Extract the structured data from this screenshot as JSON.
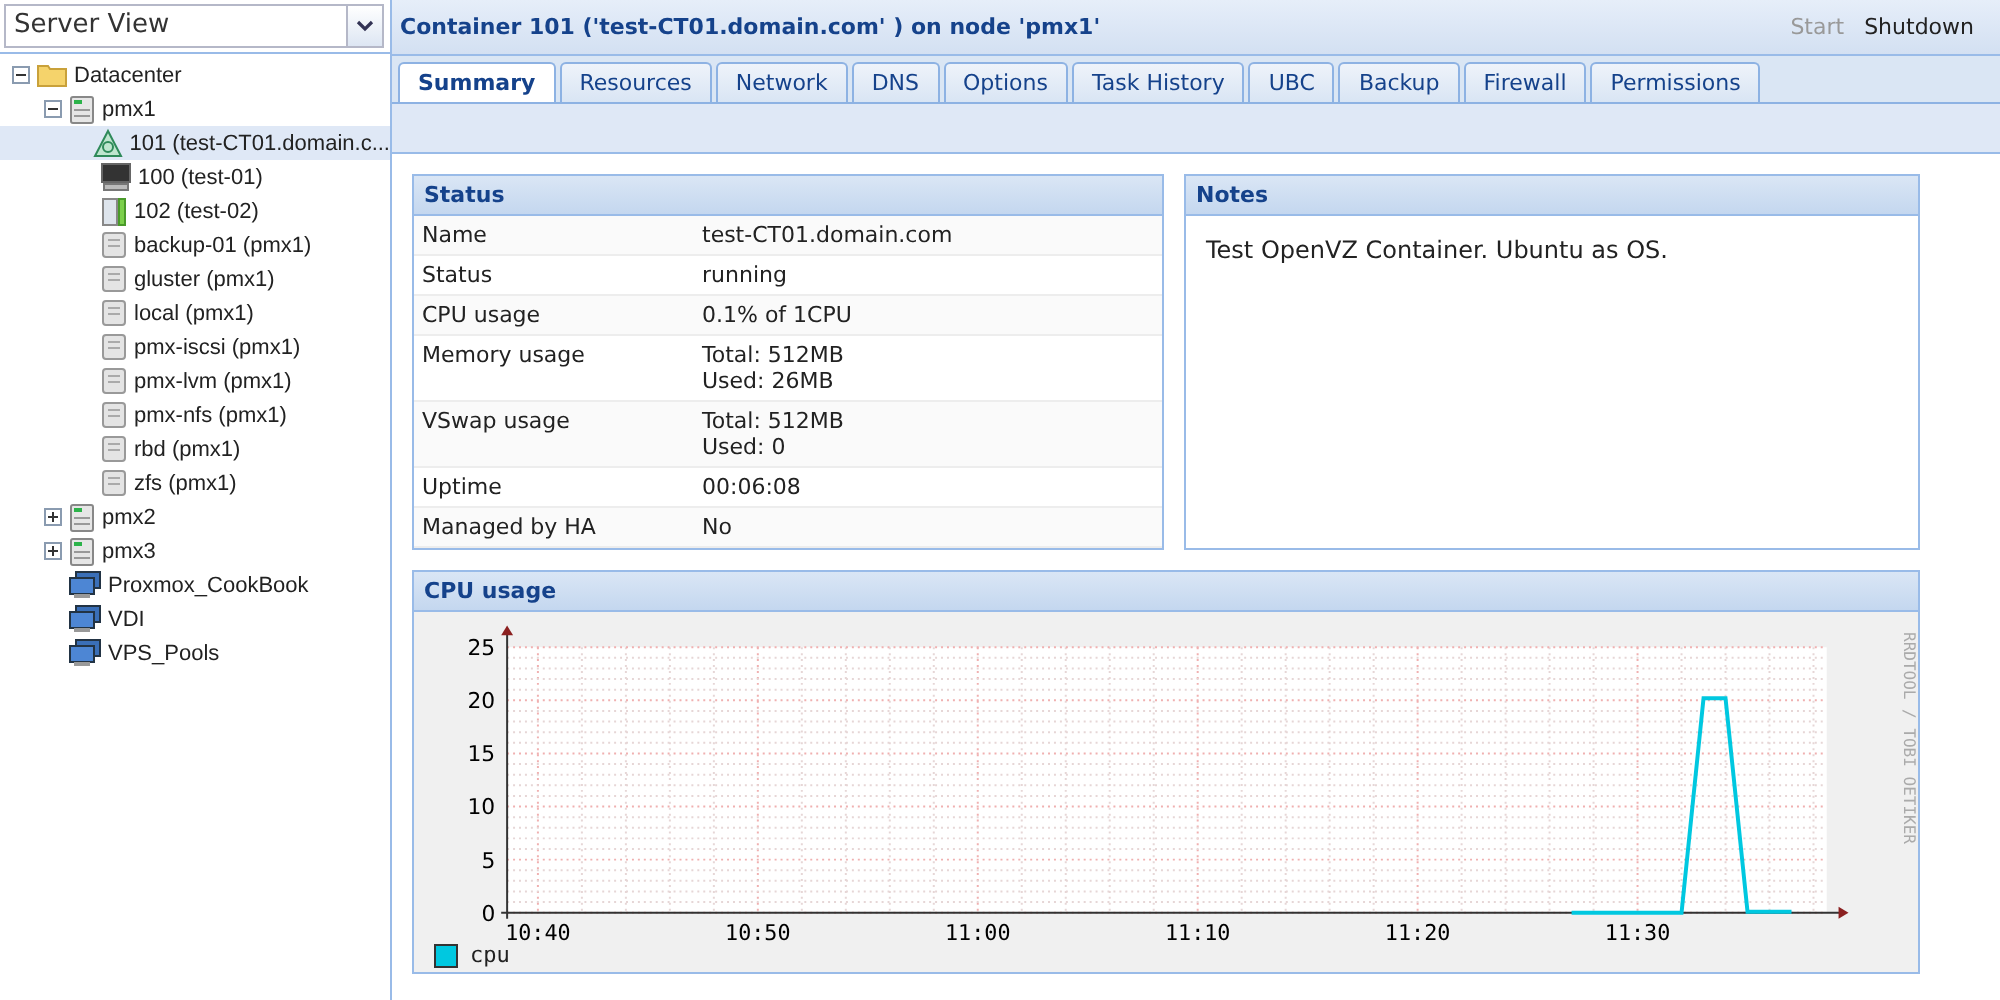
{
  "view_selector": {
    "value": "Server View"
  },
  "tree": [
    {
      "label": "Datacenter",
      "kind": "folder",
      "expanded": true,
      "selected": false,
      "children": [
        {
          "label": "pmx1",
          "kind": "node",
          "expanded": true,
          "selected": false,
          "children": [
            {
              "label": "101 (test-CT01.domain.c...",
              "kind": "container",
              "selected": true
            },
            {
              "label": "100 (test-01)",
              "kind": "vm",
              "selected": false
            },
            {
              "label": "102 (test-02)",
              "kind": "template",
              "selected": false
            },
            {
              "label": "backup-01 (pmx1)",
              "kind": "storage",
              "selected": false
            },
            {
              "label": "gluster (pmx1)",
              "kind": "storage",
              "selected": false
            },
            {
              "label": "local (pmx1)",
              "kind": "storage",
              "selected": false
            },
            {
              "label": "pmx-iscsi (pmx1)",
              "kind": "storage",
              "selected": false
            },
            {
              "label": "pmx-lvm (pmx1)",
              "kind": "storage",
              "selected": false
            },
            {
              "label": "pmx-nfs (pmx1)",
              "kind": "storage",
              "selected": false
            },
            {
              "label": "rbd (pmx1)",
              "kind": "storage",
              "selected": false
            },
            {
              "label": "zfs (pmx1)",
              "kind": "storage",
              "selected": false
            }
          ]
        },
        {
          "label": "pmx2",
          "kind": "node",
          "expanded": false,
          "selected": false
        },
        {
          "label": "pmx3",
          "kind": "node",
          "expanded": false,
          "selected": false
        },
        {
          "label": "Proxmox_CookBook",
          "kind": "pool",
          "selected": false
        },
        {
          "label": "VDI",
          "kind": "pool",
          "selected": false
        },
        {
          "label": "VPS_Pools",
          "kind": "pool",
          "selected": false
        }
      ]
    }
  ],
  "header": {
    "title": "Container 101 ('test-CT01.domain.com' ) on node 'pmx1'",
    "actions": [
      {
        "label": "Start",
        "disabled": true
      },
      {
        "label": "Shutdown",
        "disabled": false
      }
    ]
  },
  "tabs": [
    {
      "label": "Summary",
      "selected": true
    },
    {
      "label": "Resources",
      "selected": false
    },
    {
      "label": "Network",
      "selected": false
    },
    {
      "label": "DNS",
      "selected": false
    },
    {
      "label": "Options",
      "selected": false
    },
    {
      "label": "Task History",
      "selected": false
    },
    {
      "label": "UBC",
      "selected": false
    },
    {
      "label": "Backup",
      "selected": false
    },
    {
      "label": "Firewall",
      "selected": false
    },
    {
      "label": "Permissions",
      "selected": false
    }
  ],
  "status": {
    "title": "Status",
    "rows": [
      {
        "label": "Name",
        "value": [
          "test-CT01.domain.com"
        ]
      },
      {
        "label": "Status",
        "value": [
          "running"
        ]
      },
      {
        "label": "CPU usage",
        "value": [
          "0.1% of 1CPU"
        ]
      },
      {
        "label": "Memory usage",
        "value": [
          "Total: 512MB",
          "Used: 26MB"
        ]
      },
      {
        "label": "VSwap usage",
        "value": [
          "Total: 512MB",
          "Used: 0"
        ]
      },
      {
        "label": "Uptime",
        "value": [
          "00:06:08"
        ]
      },
      {
        "label": "Managed by HA",
        "value": [
          "No"
        ]
      }
    ]
  },
  "notes": {
    "title": "Notes",
    "text": "Test OpenVZ Container. Ubuntu as OS."
  },
  "cpu_panel": {
    "title": "CPU usage",
    "watermark": "RRDTOOL / TOBI OETIKER",
    "chart_data": {
      "type": "line",
      "categories": [
        null,
        "10:40",
        null,
        null,
        null,
        null,
        null,
        null,
        null,
        null,
        null,
        "10:50",
        null,
        null,
        null,
        null,
        null,
        null,
        null,
        null,
        null,
        "11:00",
        null,
        null,
        null,
        null,
        null,
        null,
        null,
        null,
        null,
        "11:10",
        null,
        null,
        null,
        null,
        null,
        null,
        null,
        null,
        null,
        "11:20",
        null,
        null,
        null,
        null,
        null,
        null,
        null,
        null,
        null,
        "11:30",
        null,
        null,
        null,
        null,
        null,
        null,
        null,
        null
      ],
      "series": [
        {
          "name": "cpu",
          "color": "#00c8e0",
          "values": [
            null,
            null,
            null,
            null,
            null,
            null,
            null,
            null,
            null,
            null,
            null,
            null,
            null,
            null,
            null,
            null,
            null,
            null,
            null,
            null,
            null,
            null,
            null,
            null,
            null,
            null,
            null,
            null,
            null,
            null,
            null,
            null,
            null,
            null,
            null,
            null,
            null,
            null,
            null,
            null,
            null,
            null,
            null,
            null,
            null,
            null,
            null,
            null,
            0,
            0,
            0,
            0,
            0,
            0,
            20.2,
            20.2,
            0.1,
            0.1,
            0.1,
            null
          ]
        }
      ],
      "ylim": [
        0,
        25
      ],
      "grid": true,
      "yticks": [
        0,
        5,
        10,
        15,
        20,
        25
      ]
    }
  }
}
